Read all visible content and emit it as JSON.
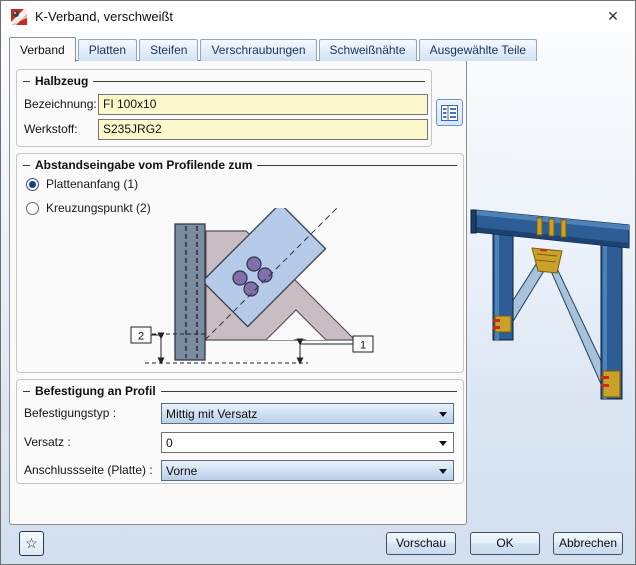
{
  "window": {
    "title": "K-Verband, verschweißt"
  },
  "icons": {
    "close": "✕",
    "favorite": "☆",
    "app_icon": "component-icon",
    "catalog": "profile-catalog-icon",
    "dropdown": "triangle-down"
  },
  "tabs": [
    {
      "label": "Verband",
      "active": true
    },
    {
      "label": "Platten",
      "active": false
    },
    {
      "label": "Steifen",
      "active": false
    },
    {
      "label": "Verschraubungen",
      "active": false
    },
    {
      "label": "Schweißnähte",
      "active": false
    },
    {
      "label": "Ausgewählte Teile",
      "active": false
    }
  ],
  "halbzeug": {
    "title": "Halbzeug",
    "bezeichnung_label": "Bezeichnung:",
    "bezeichnung_value": "FI 100x10",
    "werkstoff_label": "Werkstoff:",
    "werkstoff_value": "S235JRG2"
  },
  "abstand": {
    "title": "Abstandseingabe vom Profilende zum",
    "options": [
      {
        "label": "Plattenanfang (1)",
        "selected": true
      },
      {
        "label": "Kreuzungspunkt (2)",
        "selected": false
      }
    ],
    "marker1": "1",
    "marker2": "2"
  },
  "befestigung": {
    "title": "Befestigung an Profil",
    "rows": [
      {
        "label": "Befestigungstyp :",
        "value": "Mittig mit Versatz",
        "style": "blue"
      },
      {
        "label": "Versatz :",
        "value": "0",
        "style": "white"
      },
      {
        "label": "Anschlussseite (Platte) :",
        "value": "Vorne",
        "style": "blue"
      }
    ]
  },
  "footer": {
    "preview_label": "Vorschau",
    "ok_label": "OK",
    "cancel_label": "Abbrechen"
  },
  "colors": {
    "field_yellow": "#fbf9cc",
    "tab_text_blue": "#16355f",
    "steel_blue": "#2c5d94",
    "brace_blue": "#a7c3dc",
    "gusset_gold": "#c9a227",
    "diagram_plate_blue": "#b5cbe9",
    "diagram_gusset_pink": "#c9bcc3",
    "bolt_purple": "#8071ad"
  }
}
